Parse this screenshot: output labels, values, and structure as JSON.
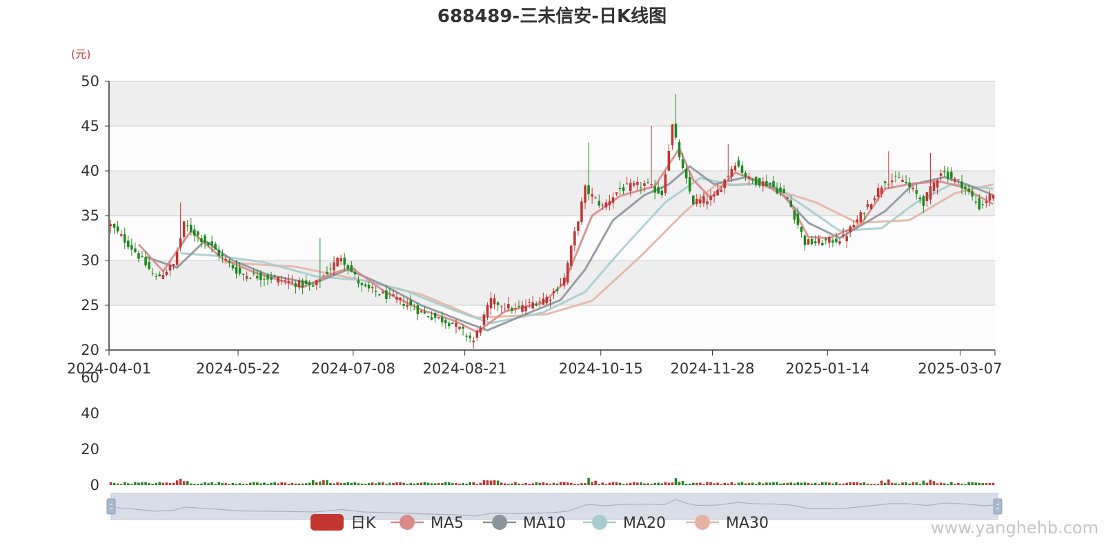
{
  "chart_data": {
    "type": "candlestick",
    "title": "688489-三未信安-日K线图",
    "yunit": "(元)",
    "ylim": [
      20,
      50
    ],
    "yticks": [
      20,
      25,
      30,
      35,
      40,
      45,
      50
    ],
    "x_start": "2024-04-01",
    "x_end": "2025-03-20",
    "xticks": [
      "2024-04-01",
      "2024-05-22",
      "2024-07-08",
      "2024-08-21",
      "2024-10-15",
      "2024-11-28",
      "2025-01-14",
      "2025-03-07"
    ],
    "grid": true,
    "legend_position": "bottom-center",
    "legend": [
      "日K",
      "MA5",
      "MA10",
      "MA20",
      "MA30"
    ],
    "up_color": "#c23531",
    "down_color": "#1c8a1c",
    "ma_colors": {
      "MA5": "#d98a8a",
      "MA10": "#8c939a",
      "MA20": "#a6cccd",
      "MA30": "#e6b2a3"
    },
    "close_anchors": [
      [
        "2024-04-01",
        33.9
      ],
      [
        "2024-04-10",
        31.0
      ],
      [
        "2024-04-18",
        28.0
      ],
      [
        "2024-04-25",
        29.5
      ],
      [
        "2024-04-30",
        34.0
      ],
      [
        "2024-05-10",
        31.5
      ],
      [
        "2024-05-22",
        28.5
      ],
      [
        "2024-06-05",
        28.0
      ],
      [
        "2024-06-20",
        27.0
      ],
      [
        "2024-07-02",
        30.5
      ],
      [
        "2024-07-10",
        27.0
      ],
      [
        "2024-07-25",
        25.5
      ],
      [
        "2024-08-05",
        24.0
      ],
      [
        "2024-08-15",
        23.0
      ],
      [
        "2024-08-23",
        21.0
      ],
      [
        "2024-08-30",
        25.5
      ],
      [
        "2024-09-10",
        24.5
      ],
      [
        "2024-09-24",
        26.0
      ],
      [
        "2024-09-30",
        28.0
      ],
      [
        "2024-10-08",
        38.0
      ],
      [
        "2024-10-15",
        36.0
      ],
      [
        "2024-10-22",
        38.0
      ],
      [
        "2024-10-31",
        38.5
      ],
      [
        "2024-11-07",
        37.5
      ],
      [
        "2024-11-12",
        45.0
      ],
      [
        "2024-11-15",
        40.0
      ],
      [
        "2024-11-20",
        36.5
      ],
      [
        "2024-11-28",
        37.0
      ],
      [
        "2024-12-06",
        41.0
      ],
      [
        "2024-12-12",
        39.0
      ],
      [
        "2024-12-20",
        38.5
      ],
      [
        "2024-12-27",
        37.0
      ],
      [
        "2025-01-03",
        32.0
      ],
      [
        "2025-01-10",
        32.0
      ],
      [
        "2025-01-20",
        32.5
      ],
      [
        "2025-01-27",
        35.0
      ],
      [
        "2025-02-05",
        39.0
      ],
      [
        "2025-02-12",
        39.0
      ],
      [
        "2025-02-20",
        36.5
      ],
      [
        "2025-02-27",
        40.0
      ],
      [
        "2025-03-07",
        38.5
      ],
      [
        "2025-03-14",
        36.0
      ],
      [
        "2025-03-20",
        37.5
      ]
    ],
    "spikes": [
      [
        "2024-04-29",
        36.5
      ],
      [
        "2024-06-24",
        32.5
      ],
      [
        "2024-10-09",
        43.2
      ],
      [
        "2024-11-04",
        45.0
      ],
      [
        "2024-11-13",
        48.6
      ],
      [
        "2024-12-04",
        43.0
      ],
      [
        "2025-02-06",
        42.2
      ],
      [
        "2025-02-24",
        42.0
      ]
    ],
    "ma_anchors": {
      "MA5": [
        [
          "2024-04-11",
          31.8
        ],
        [
          "2024-04-22",
          28.8
        ],
        [
          "2024-05-02",
          33.3
        ],
        [
          "2024-05-15",
          30.2
        ],
        [
          "2024-05-28",
          28.7
        ],
        [
          "2024-06-17",
          27.0
        ],
        [
          "2024-06-28",
          28.6
        ],
        [
          "2024-07-05",
          29.2
        ],
        [
          "2024-07-19",
          26.4
        ],
        [
          "2024-08-02",
          24.5
        ],
        [
          "2024-08-16",
          23.2
        ],
        [
          "2024-08-26",
          22.0
        ],
        [
          "2024-09-05",
          24.3
        ],
        [
          "2024-09-20",
          25.3
        ],
        [
          "2024-09-30",
          27.5
        ],
        [
          "2024-10-10",
          35.0
        ],
        [
          "2024-10-22",
          37.2
        ],
        [
          "2024-11-05",
          38.3
        ],
        [
          "2024-11-14",
          42.5
        ],
        [
          "2024-11-20",
          39.0
        ],
        [
          "2024-11-27",
          37.0
        ],
        [
          "2024-12-06",
          39.8
        ],
        [
          "2024-12-16",
          39.0
        ],
        [
          "2024-12-27",
          37.0
        ],
        [
          "2025-01-06",
          32.6
        ],
        [
          "2025-01-14",
          32.5
        ],
        [
          "2025-01-27",
          34.0
        ],
        [
          "2025-02-05",
          38.0
        ],
        [
          "2025-02-17",
          38.6
        ],
        [
          "2025-02-27",
          38.8
        ],
        [
          "2025-03-07",
          38.2
        ],
        [
          "2025-03-20",
          36.3
        ]
      ],
      "MA10": [
        [
          "2024-04-15",
          30.4
        ],
        [
          "2024-04-26",
          29.2
        ],
        [
          "2024-05-08",
          32.2
        ],
        [
          "2024-05-20",
          30.0
        ],
        [
          "2024-06-03",
          28.4
        ],
        [
          "2024-06-20",
          27.4
        ],
        [
          "2024-07-04",
          29.0
        ],
        [
          "2024-07-18",
          27.3
        ],
        [
          "2024-08-02",
          25.0
        ],
        [
          "2024-08-20",
          23.2
        ],
        [
          "2024-08-29",
          22.2
        ],
        [
          "2024-09-13",
          24.0
        ],
        [
          "2024-09-27",
          25.6
        ],
        [
          "2024-10-08",
          29.0
        ],
        [
          "2024-10-18",
          34.5
        ],
        [
          "2024-10-31",
          37.3
        ],
        [
          "2024-11-11",
          38.5
        ],
        [
          "2024-11-19",
          40.5
        ],
        [
          "2024-11-28",
          38.5
        ],
        [
          "2024-12-11",
          39.3
        ],
        [
          "2024-12-24",
          38.0
        ],
        [
          "2025-01-06",
          34.2
        ],
        [
          "2025-01-17",
          32.5
        ],
        [
          "2025-02-05",
          35.5
        ],
        [
          "2025-02-17",
          38.5
        ],
        [
          "2025-02-28",
          39.3
        ],
        [
          "2025-03-11",
          38.4
        ],
        [
          "2025-03-20",
          37.3
        ]
      ],
      "MA20": [
        [
          "2024-04-29",
          30.8
        ],
        [
          "2024-05-14",
          30.5
        ],
        [
          "2024-05-31",
          29.8
        ],
        [
          "2024-06-21",
          28.2
        ],
        [
          "2024-07-10",
          27.8
        ],
        [
          "2024-07-26",
          26.7
        ],
        [
          "2024-08-15",
          24.5
        ],
        [
          "2024-08-30",
          23.0
        ],
        [
          "2024-09-20",
          24.2
        ],
        [
          "2024-10-08",
          26.5
        ],
        [
          "2024-10-22",
          31.0
        ],
        [
          "2024-11-08",
          36.5
        ],
        [
          "2024-11-22",
          39.2
        ],
        [
          "2024-12-06",
          38.4
        ],
        [
          "2024-12-20",
          38.6
        ],
        [
          "2025-01-03",
          36.0
        ],
        [
          "2025-01-17",
          33.3
        ],
        [
          "2025-02-04",
          33.6
        ],
        [
          "2025-02-18",
          36.5
        ],
        [
          "2025-03-04",
          38.5
        ],
        [
          "2025-03-20",
          38.0
        ]
      ],
      "MA30": [
        [
          "2024-05-15",
          29.8
        ],
        [
          "2024-06-13",
          29.3
        ],
        [
          "2024-07-10",
          27.8
        ],
        [
          "2024-08-02",
          26.2
        ],
        [
          "2024-08-26",
          23.6
        ],
        [
          "2024-09-23",
          24.0
        ],
        [
          "2024-10-10",
          25.5
        ],
        [
          "2024-10-30",
          30.5
        ],
        [
          "2024-11-15",
          35.2
        ],
        [
          "2024-11-28",
          38.3
        ],
        [
          "2024-12-16",
          38.6
        ],
        [
          "2025-01-08",
          36.5
        ],
        [
          "2025-01-24",
          34.2
        ],
        [
          "2025-02-14",
          34.5
        ],
        [
          "2025-03-05",
          37.5
        ],
        [
          "2025-03-20",
          38.5
        ]
      ]
    },
    "volume": {
      "yticks": [
        0,
        20,
        40,
        60
      ],
      "ylim": [
        0,
        60
      ],
      "typical": 1.2,
      "peaks": [
        [
          "2024-04-29",
          3.5
        ],
        [
          "2024-06-24",
          2.0
        ],
        [
          "2024-08-30",
          2.5
        ],
        [
          "2024-10-09",
          4.0
        ],
        [
          "2024-11-13",
          3.8
        ],
        [
          "2025-02-06",
          3.2
        ],
        [
          "2025-02-24",
          3.0
        ]
      ]
    }
  },
  "watermark": "www.yanghehb.com"
}
